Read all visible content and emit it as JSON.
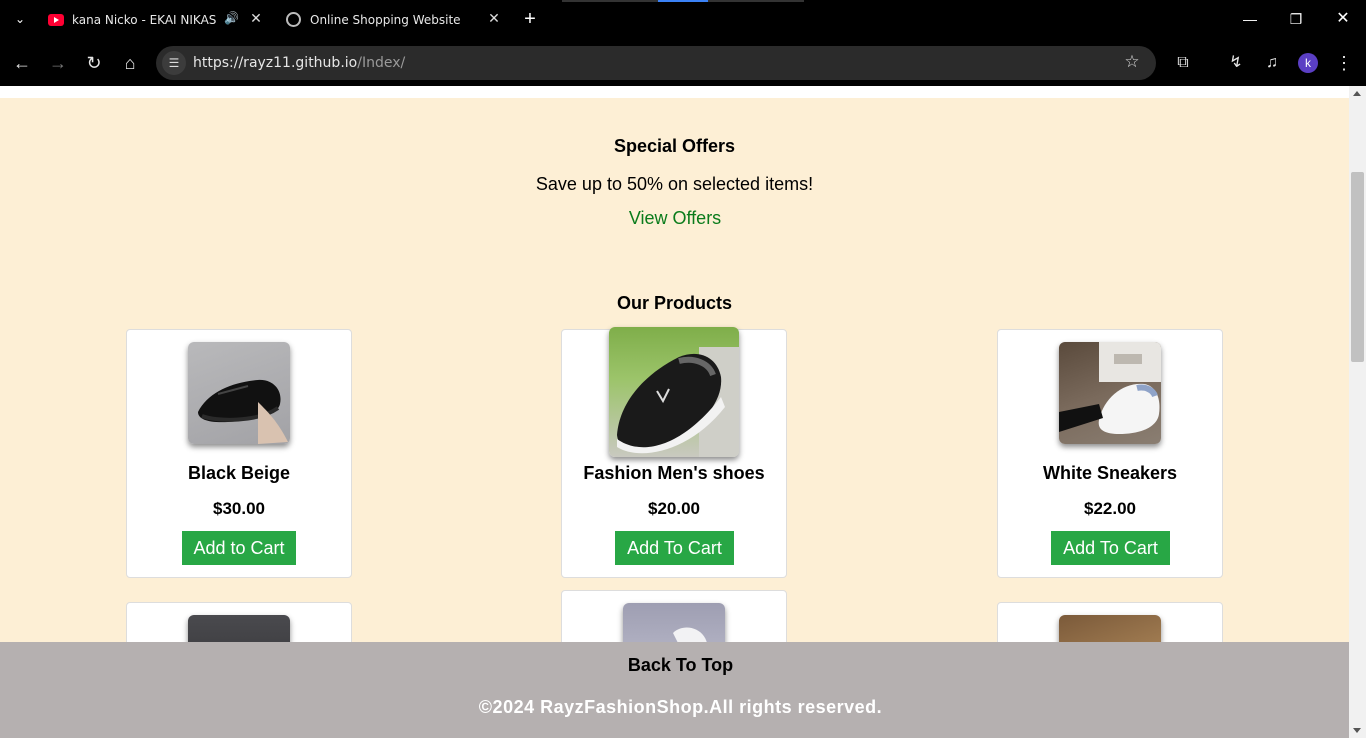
{
  "browser": {
    "tabs": [
      {
        "title": "kana Nicko - EKAI NIKASE (",
        "favicon": "youtube-icon",
        "audio": true,
        "active": false
      },
      {
        "title": "Online Shopping Website",
        "favicon": "globe-icon",
        "active": true
      }
    ],
    "url_host": "https://rayz11.github.io",
    "url_path": "/Index/",
    "profile_initial": "k",
    "colors": {
      "chrome_bg": "#000000",
      "omnibox_bg": "#2b2b2b",
      "avatar": "#5b3fc4"
    }
  },
  "offers": {
    "title": "Special Offers",
    "text": "Save up to 50% on selected items!",
    "link": "View Offers"
  },
  "products": {
    "title": "Our Products",
    "items": [
      {
        "name": "Black Beige",
        "price": "$30.00",
        "button": "Add to Cart",
        "image": "black-leather-shoe"
      },
      {
        "name": "Fashion Men's shoes",
        "price": "$20.00",
        "button": "Add To Cart",
        "image": "black-slip-on-shoe"
      },
      {
        "name": "White Sneakers",
        "price": "$22.00",
        "button": "Add To Cart",
        "image": "white-sneaker"
      },
      {
        "image": "dark-shoe"
      },
      {
        "image": "grey-sneaker"
      },
      {
        "image": "tan-shoe"
      }
    ]
  },
  "footer": {
    "back_to_top": "Back To Top",
    "copyright": "©2024 RayzFashionShop.All rights reserved."
  },
  "colors": {
    "page_bg": "#fdefd5",
    "button_green": "#28a745",
    "link_green": "#0a7b1b",
    "footer_bg": "#b5b0b0"
  }
}
